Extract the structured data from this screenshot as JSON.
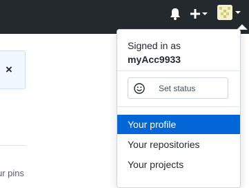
{
  "header": {
    "background": "#24292e",
    "icons": [
      "bell-icon",
      "plus-icon",
      "chevron-down-icon",
      "avatar"
    ]
  },
  "page": {
    "flash_close": "×",
    "pins_text": "ur pins"
  },
  "dropdown": {
    "signed_in_label": "Signed in as",
    "username": "myAcc9933",
    "set_status_label": "Set status",
    "items": [
      {
        "label": "Your profile",
        "active": true
      },
      {
        "label": "Your repositories",
        "active": false
      },
      {
        "label": "Your projects",
        "active": false
      }
    ],
    "active_color": "#0366d6"
  }
}
